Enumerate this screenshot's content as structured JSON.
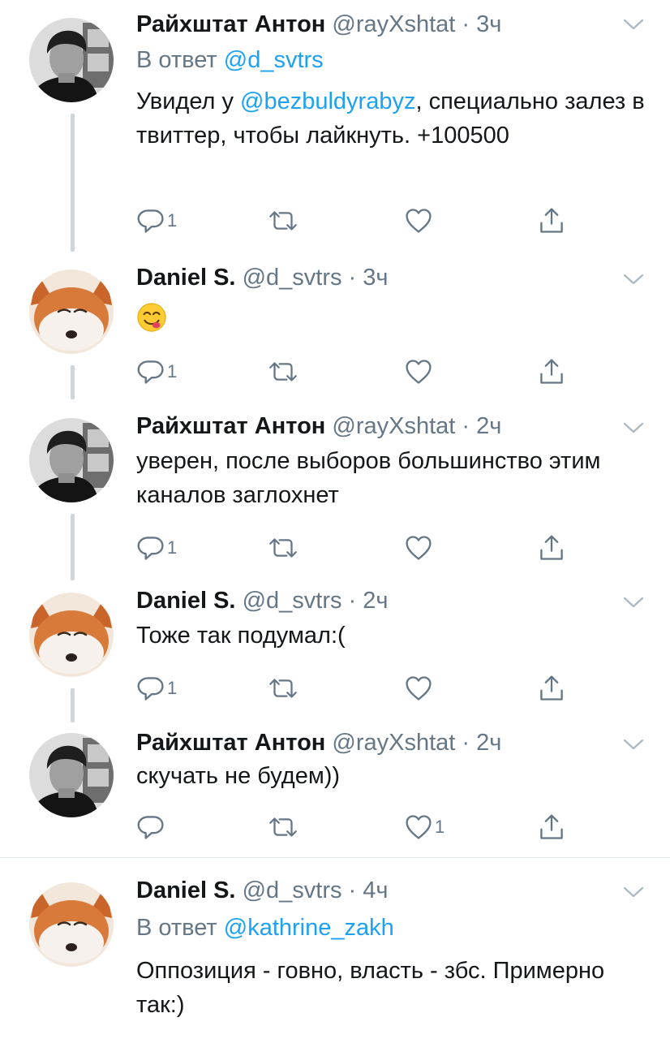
{
  "tweets": [
    {
      "name": "Райхштат Антон",
      "handle": "@rayXshtat",
      "dot": "·",
      "time": "3ч",
      "reply_prefix": "В ответ",
      "reply_to": "@d_svtrs",
      "text_parts": [
        "Увидел у ",
        "@bezbuldyrabyz",
        ", специально залез в твиттер, чтобы лайкнуть. +100500"
      ],
      "reply_count": "1",
      "like_count": ""
    },
    {
      "name": "Daniel S.",
      "handle": "@d_svtrs",
      "dot": "·",
      "time": "3ч",
      "emoji": "face-savoring-food-emoji",
      "reply_count": "1",
      "like_count": ""
    },
    {
      "name": "Райхштат Антон",
      "handle": "@rayXshtat",
      "dot": "·",
      "time": "2ч",
      "text": "уверен, после выборов большинство этим каналов заглохнет",
      "reply_count": "1",
      "like_count": ""
    },
    {
      "name": "Daniel S.",
      "handle": "@d_svtrs",
      "dot": "·",
      "time": "2ч",
      "text": "Тоже так подумал:(",
      "reply_count": "1",
      "like_count": ""
    },
    {
      "name": "Райхштат Антон",
      "handle": "@rayXshtat",
      "dot": "·",
      "time": "2ч",
      "text": "скучать не будем))",
      "reply_count": "",
      "like_count": "1"
    },
    {
      "name": "Daniel S.",
      "handle": "@d_svtrs",
      "dot": "·",
      "time": "4ч",
      "reply_prefix": "В ответ",
      "reply_to": "@kathrine_zakh",
      "text": "Оппозиция - говно, власть - збс. Примерно так:)"
    }
  ],
  "icons": {
    "reply": "reply-icon",
    "retweet": "retweet-icon",
    "like": "heart-icon",
    "share": "share-icon",
    "menu": "chevron-down-icon"
  },
  "colors": {
    "link": "#1da1f2",
    "secondary_text": "#657786",
    "thread_line": "#cdd6dd",
    "divider": "#e1e8ed"
  }
}
